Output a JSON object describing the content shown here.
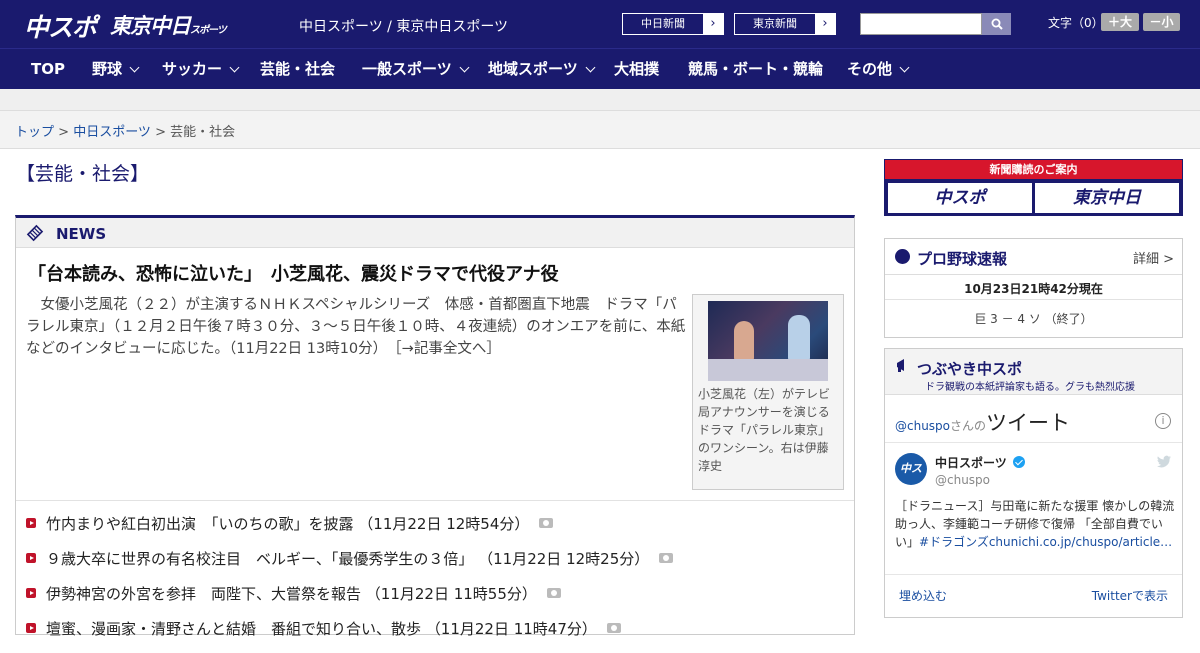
{
  "header": {
    "logo_chuspo": "中スポ",
    "logo_tokyo": "東京中日",
    "logo_tokyo_small": "スポーツ",
    "site_names": "中日スポーツ / 東京中日スポーツ",
    "paper_buttons": [
      {
        "label": "中日新聞",
        "arrow": "›"
      },
      {
        "label": "東京新聞",
        "arrow": "›"
      }
    ],
    "search_placeholder": "",
    "search_icon": "search-icon",
    "font_size_label": "文字（0）",
    "font_larger": "＋大",
    "font_smaller": "－小"
  },
  "nav": [
    {
      "label": "TOP",
      "has_menu": false
    },
    {
      "label": "野球",
      "has_menu": true
    },
    {
      "label": "サッカー",
      "has_menu": true
    },
    {
      "label": "芸能・社会",
      "has_menu": false
    },
    {
      "label": "一般スポーツ",
      "has_menu": true
    },
    {
      "label": "地域スポーツ",
      "has_menu": true
    },
    {
      "label": "大相撲",
      "has_menu": false
    },
    {
      "label": "競馬・ボート・競輪",
      "has_menu": false
    },
    {
      "label": "その他",
      "has_menu": true
    }
  ],
  "breadcrumb": {
    "home": "トップ",
    "sep1": " > ",
    "section": "中日スポーツ",
    "sep2": " > ",
    "current": "芸能・社会"
  },
  "section_title": "【芸能・社会】",
  "news": {
    "label": "NEWS",
    "headline": "「台本読み、恐怖に泣いた」　小芝風花、震災ドラマで代役アナ役",
    "lead": "女優小芝風花（２２）が主演するＮＨＫスペシャルシリーズ　体感・首都圏直下地震　ドラマ「パラレル東京」（１２月２日午後７時３０分、３～５日午後１０時、４夜連続）のオンエアを前に、本紙などのインタビューに応じた。（11月22日 13時10分）",
    "lead_link": "［→記事全文へ］",
    "caption": "小芝風花（左）がテレビ局アナウンサーを演じるドラマ「パラレル東京」のワンシーン。右は伊藤淳史",
    "items": [
      {
        "text": "竹内まりや紅白初出演　「いのちの歌」を披露 （11月22日 12時54分）",
        "photo": true
      },
      {
        "text": "９歳大卒に世界の有名校注目　ベルギー、「最優秀学生の３倍」 （11月22日 12時25分）",
        "photo": true
      },
      {
        "text": "伊勢神宮の外宮を参拝　両陛下、大嘗祭を報告 （11月22日 11時55分）",
        "photo": true
      },
      {
        "text": "壇蜜、漫画家・清野さんと結婚　番組で知り合い、散歩 （11月22日 11時47分）",
        "photo": true
      }
    ]
  },
  "sidebar": {
    "subscribe": {
      "title": "新聞購読のご案内",
      "chuspo": "中スポ",
      "tokyo": "東京中日"
    },
    "baseball": {
      "title": "プロ野球速報",
      "more": "詳細 >",
      "time": "10月23日21時42分現在",
      "score": "巨 3 － 4 ソ （終了）"
    },
    "tweets": {
      "title": "つぶやき中スポ",
      "subtitle": "ドラ観戦の本紙評論家も語る。グラも熱烈応援",
      "handle_prefix": "@chuspo",
      "handle_suffix": "さんの",
      "heading": "ツイート",
      "info": "i",
      "avatar": "中スポ",
      "account_name": "中日スポーツ",
      "account_handle": "@chuspo",
      "tweet_text": "［ドラニュース］与田竜に新たな援軍 懐かしの韓流助っ人、李鍾範コーチ研修で復帰 「全部自費でいい」",
      "tweet_link": "#ドラゴンズchunichi.co.jp/chuspo/article…",
      "embed": "埋め込む",
      "view_on_twitter": "Twitterで表示"
    }
  },
  "colors": {
    "brand_navy": "#1a1a6e",
    "accent_red": "#d7162c",
    "link_blue": "#1a4ea0"
  }
}
